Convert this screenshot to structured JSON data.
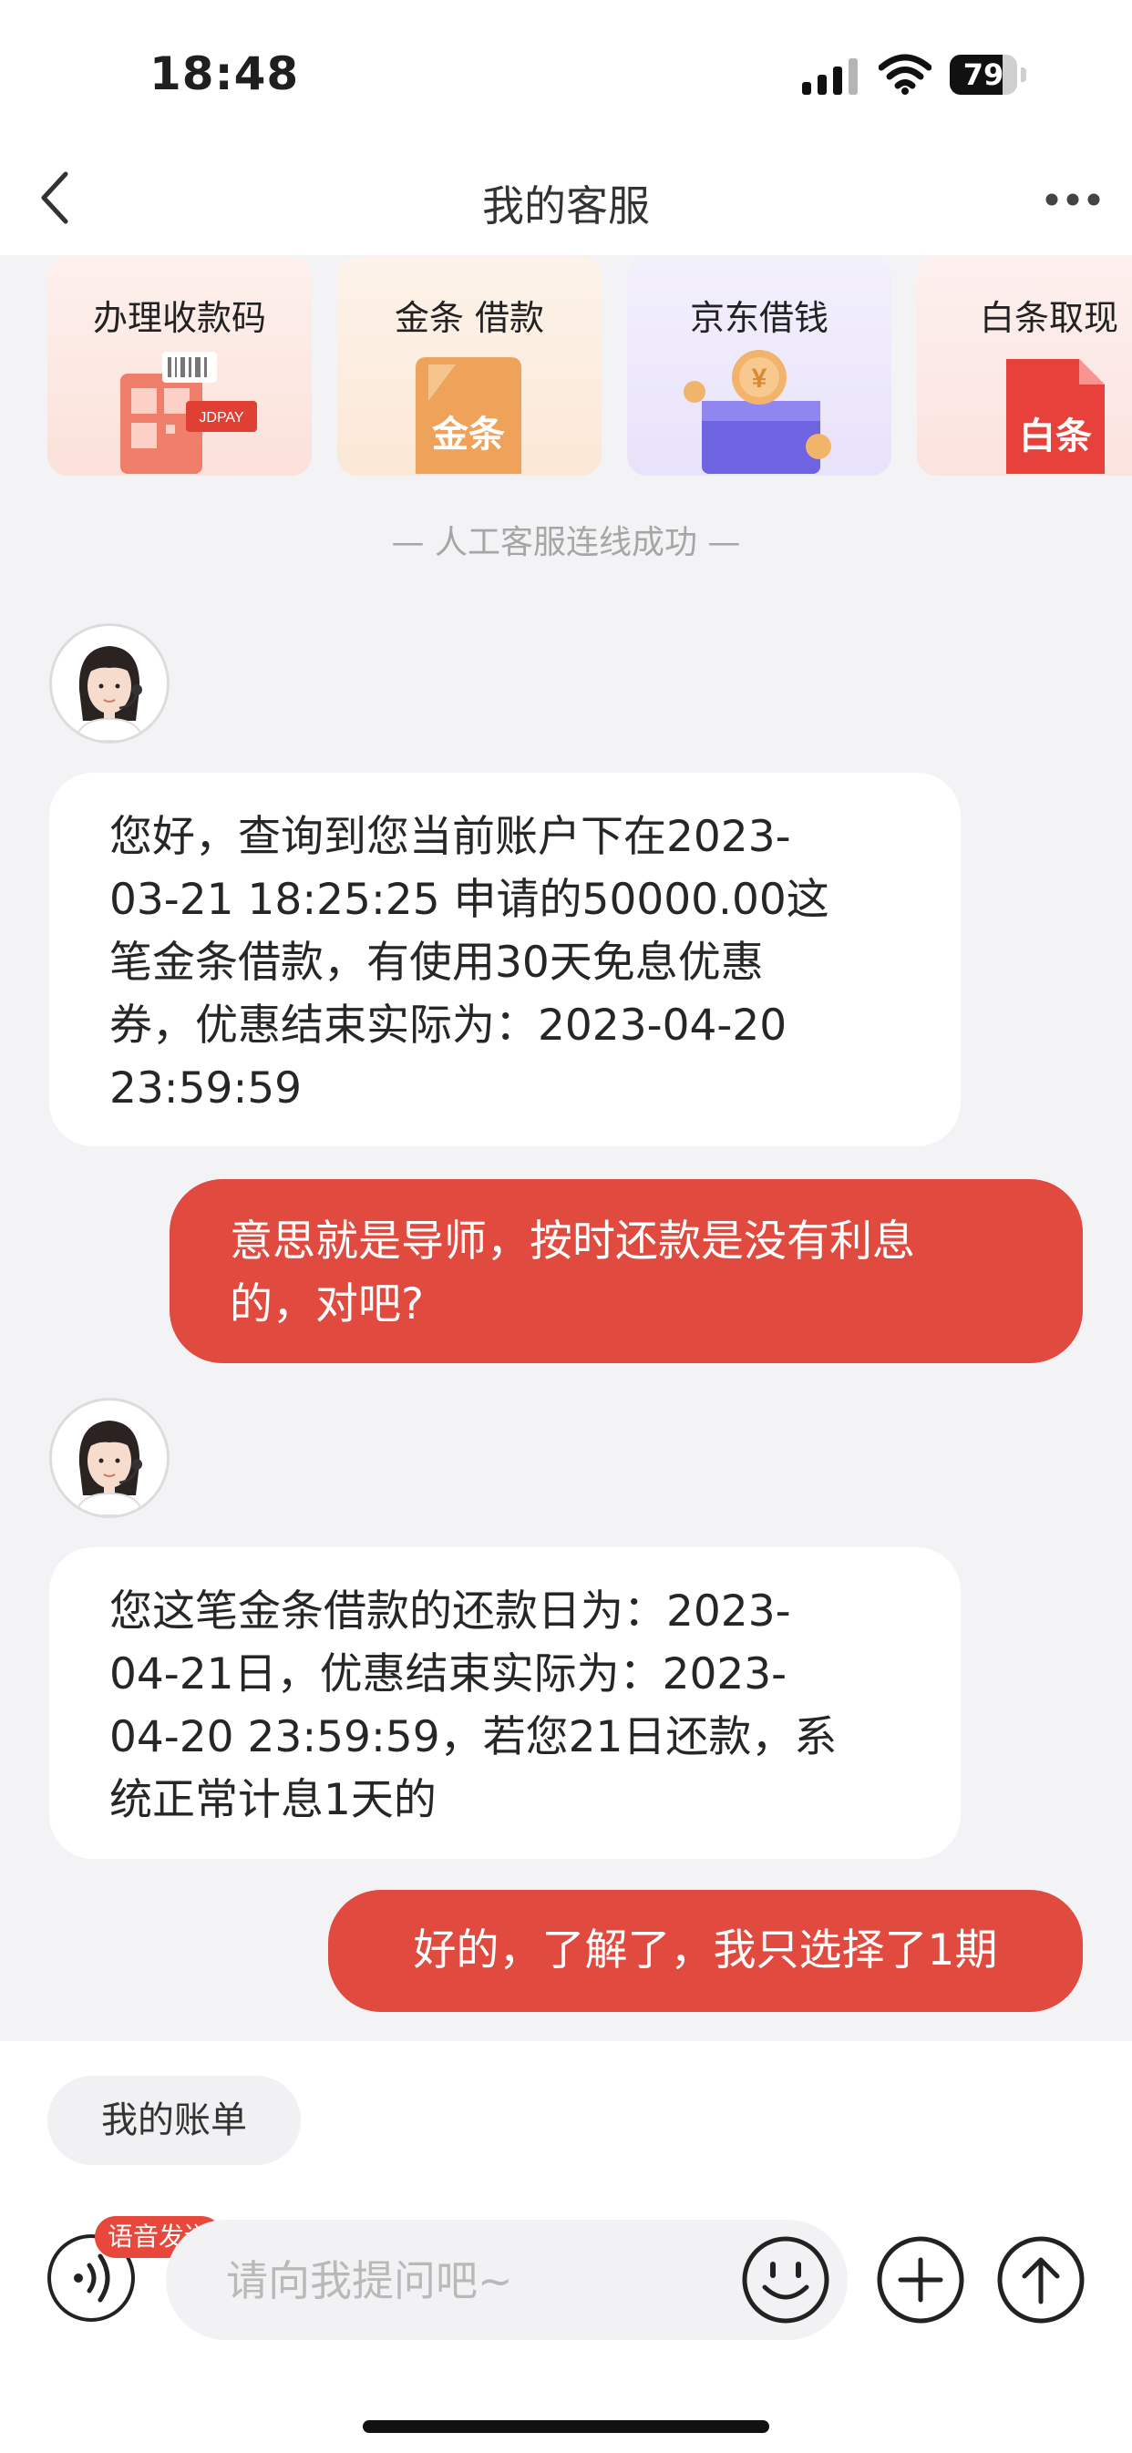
{
  "status_bar": {
    "time": "18:48",
    "battery": "79",
    "battery_level": 0.79
  },
  "header": {
    "title": "我的客服"
  },
  "service_cards": [
    {
      "label": "办理收款码",
      "badge_text": "JDPAY"
    },
    {
      "label": "金条 借款",
      "badge_text": "金条"
    },
    {
      "label": "京东借钱",
      "badge_text": "¥"
    },
    {
      "label": "白条取现",
      "badge_text": "白条"
    }
  ],
  "system_notice": "— 人工客服连线成功 —",
  "messages": [
    {
      "sender": "agent",
      "lines": [
        "您好，查询到您当前账户下在2023-",
        "03-21 18:25:25 申请的50000.00这",
        "笔金条借款，有使用30天免息优惠",
        "券，优惠结束实际为：2023-04-20",
        "23:59:59"
      ]
    },
    {
      "sender": "user",
      "lines": [
        "意思就是导师，按时还款是没有利息",
        "的，对吧?"
      ]
    },
    {
      "sender": "agent",
      "lines": [
        "您这笔金条借款的还款日为：2023-",
        "04-21日，优惠结束实际为：2023-",
        "04-20 23:59:59，若您21日还款，系",
        "统正常计息1天的"
      ]
    },
    {
      "sender": "user",
      "lines": [
        "好的，了解了，我只选择了1期"
      ]
    }
  ],
  "quick_reply": {
    "label": "我的账单"
  },
  "input_bar": {
    "voice_tag": "语音发送",
    "placeholder": "请向我提问吧~",
    "value": ""
  },
  "colors": {
    "accent": "#e04a3f",
    "background": "#f3f3f5",
    "bubble_agent": "#ffffff"
  }
}
